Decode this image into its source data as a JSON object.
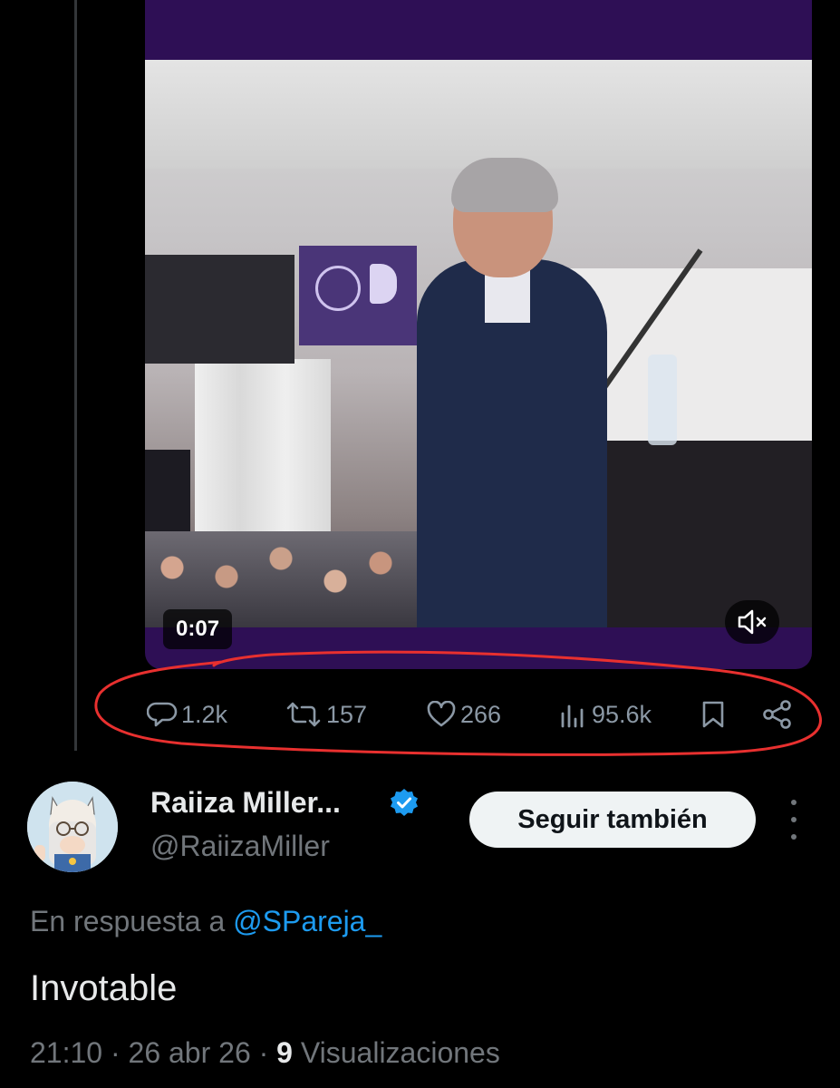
{
  "video": {
    "timestamp": "0:07",
    "mute_icon": "speaker-muted-icon",
    "accent": "#2e0f55"
  },
  "actions": {
    "replies": "1.2k",
    "reposts": "157",
    "likes": "266",
    "views": "95.6k",
    "color": "#8b98a5"
  },
  "reply": {
    "display_name": "Raiiza Miller...",
    "handle": "@RaiizaMiller",
    "follow_label": "Seguir también",
    "reply_prefix": "En respuesta a",
    "reply_to": "@SPareja_",
    "text": "Invotable",
    "time": "21:10 · 26 abr 26 · ",
    "views_count": "9",
    "views_label": " Visualizaciones",
    "link_color": "#1d9bf0"
  },
  "annotation_color": "#e8302f"
}
